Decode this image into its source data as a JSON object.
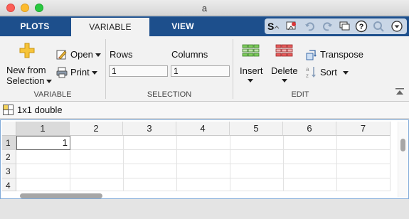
{
  "window": {
    "title": "a"
  },
  "tabs": [
    {
      "label": "PLOTS",
      "active": false
    },
    {
      "label": "VARIABLE",
      "active": true
    },
    {
      "label": "VIEW",
      "active": false
    }
  ],
  "ribbon": {
    "variable_group": {
      "label": "VARIABLE",
      "new_from_selection_line1": "New from",
      "new_from_selection_line2": "Selection",
      "open_label": "Open",
      "print_label": "Print"
    },
    "selection_group": {
      "label": "SELECTION",
      "rows_label": "Rows",
      "columns_label": "Columns",
      "rows_value": "1",
      "columns_value": "1"
    },
    "edit_group": {
      "label": "EDIT",
      "insert_label": "Insert",
      "delete_label": "Delete",
      "transpose_label": "Transpose",
      "sort_label": "Sort"
    }
  },
  "variable": {
    "title": "1x1 double"
  },
  "grid": {
    "columns": [
      "1",
      "2",
      "3",
      "4",
      "5",
      "6",
      "7"
    ],
    "rows": [
      "1",
      "2",
      "3",
      "4"
    ],
    "cells": [
      [
        "1",
        "",
        "",
        "",
        "",
        "",
        ""
      ],
      [
        "",
        "",
        "",
        "",
        "",
        "",
        ""
      ],
      [
        "",
        "",
        "",
        "",
        "",
        "",
        ""
      ],
      [
        "",
        "",
        "",
        "",
        "",
        "",
        ""
      ]
    ]
  },
  "colors": {
    "tabstrip": "#1d4f8c",
    "ribbon": "#f2f2f2",
    "grid_border": "#7fa9d8"
  }
}
